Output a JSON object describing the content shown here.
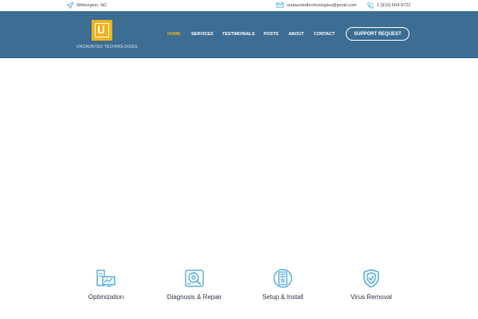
{
  "topbar": {
    "location": "Wilmington, NC",
    "email": "undauntedtechnologies@gmail.com",
    "phone": "1 (910) 604-9722"
  },
  "brand": {
    "name": "UNDAUNTED TECHNOLOGIES",
    "accent_color": "#f3b21c",
    "header_color": "#3c6d93"
  },
  "nav": {
    "items": [
      {
        "label": "HOME",
        "active": true
      },
      {
        "label": "SERVICES"
      },
      {
        "label": "TESTIMONIALS"
      },
      {
        "label": "POSTS"
      },
      {
        "label": "ABOUT"
      },
      {
        "label": "CONTACT"
      }
    ],
    "cta_label": "SUPPORT REQUEST"
  },
  "services": [
    {
      "label": "Optimization",
      "icon": "optimization-icon"
    },
    {
      "label": "Diagnosis & Repair",
      "icon": "diagnosis-repair-icon"
    },
    {
      "label": "Setup & Install",
      "icon": "setup-install-icon"
    },
    {
      "label": "Virus Removal",
      "icon": "virus-removal-icon"
    }
  ],
  "icon_names": {
    "location": "location-arrow-icon",
    "email": "envelope-icon",
    "phone": "phone-icon"
  }
}
